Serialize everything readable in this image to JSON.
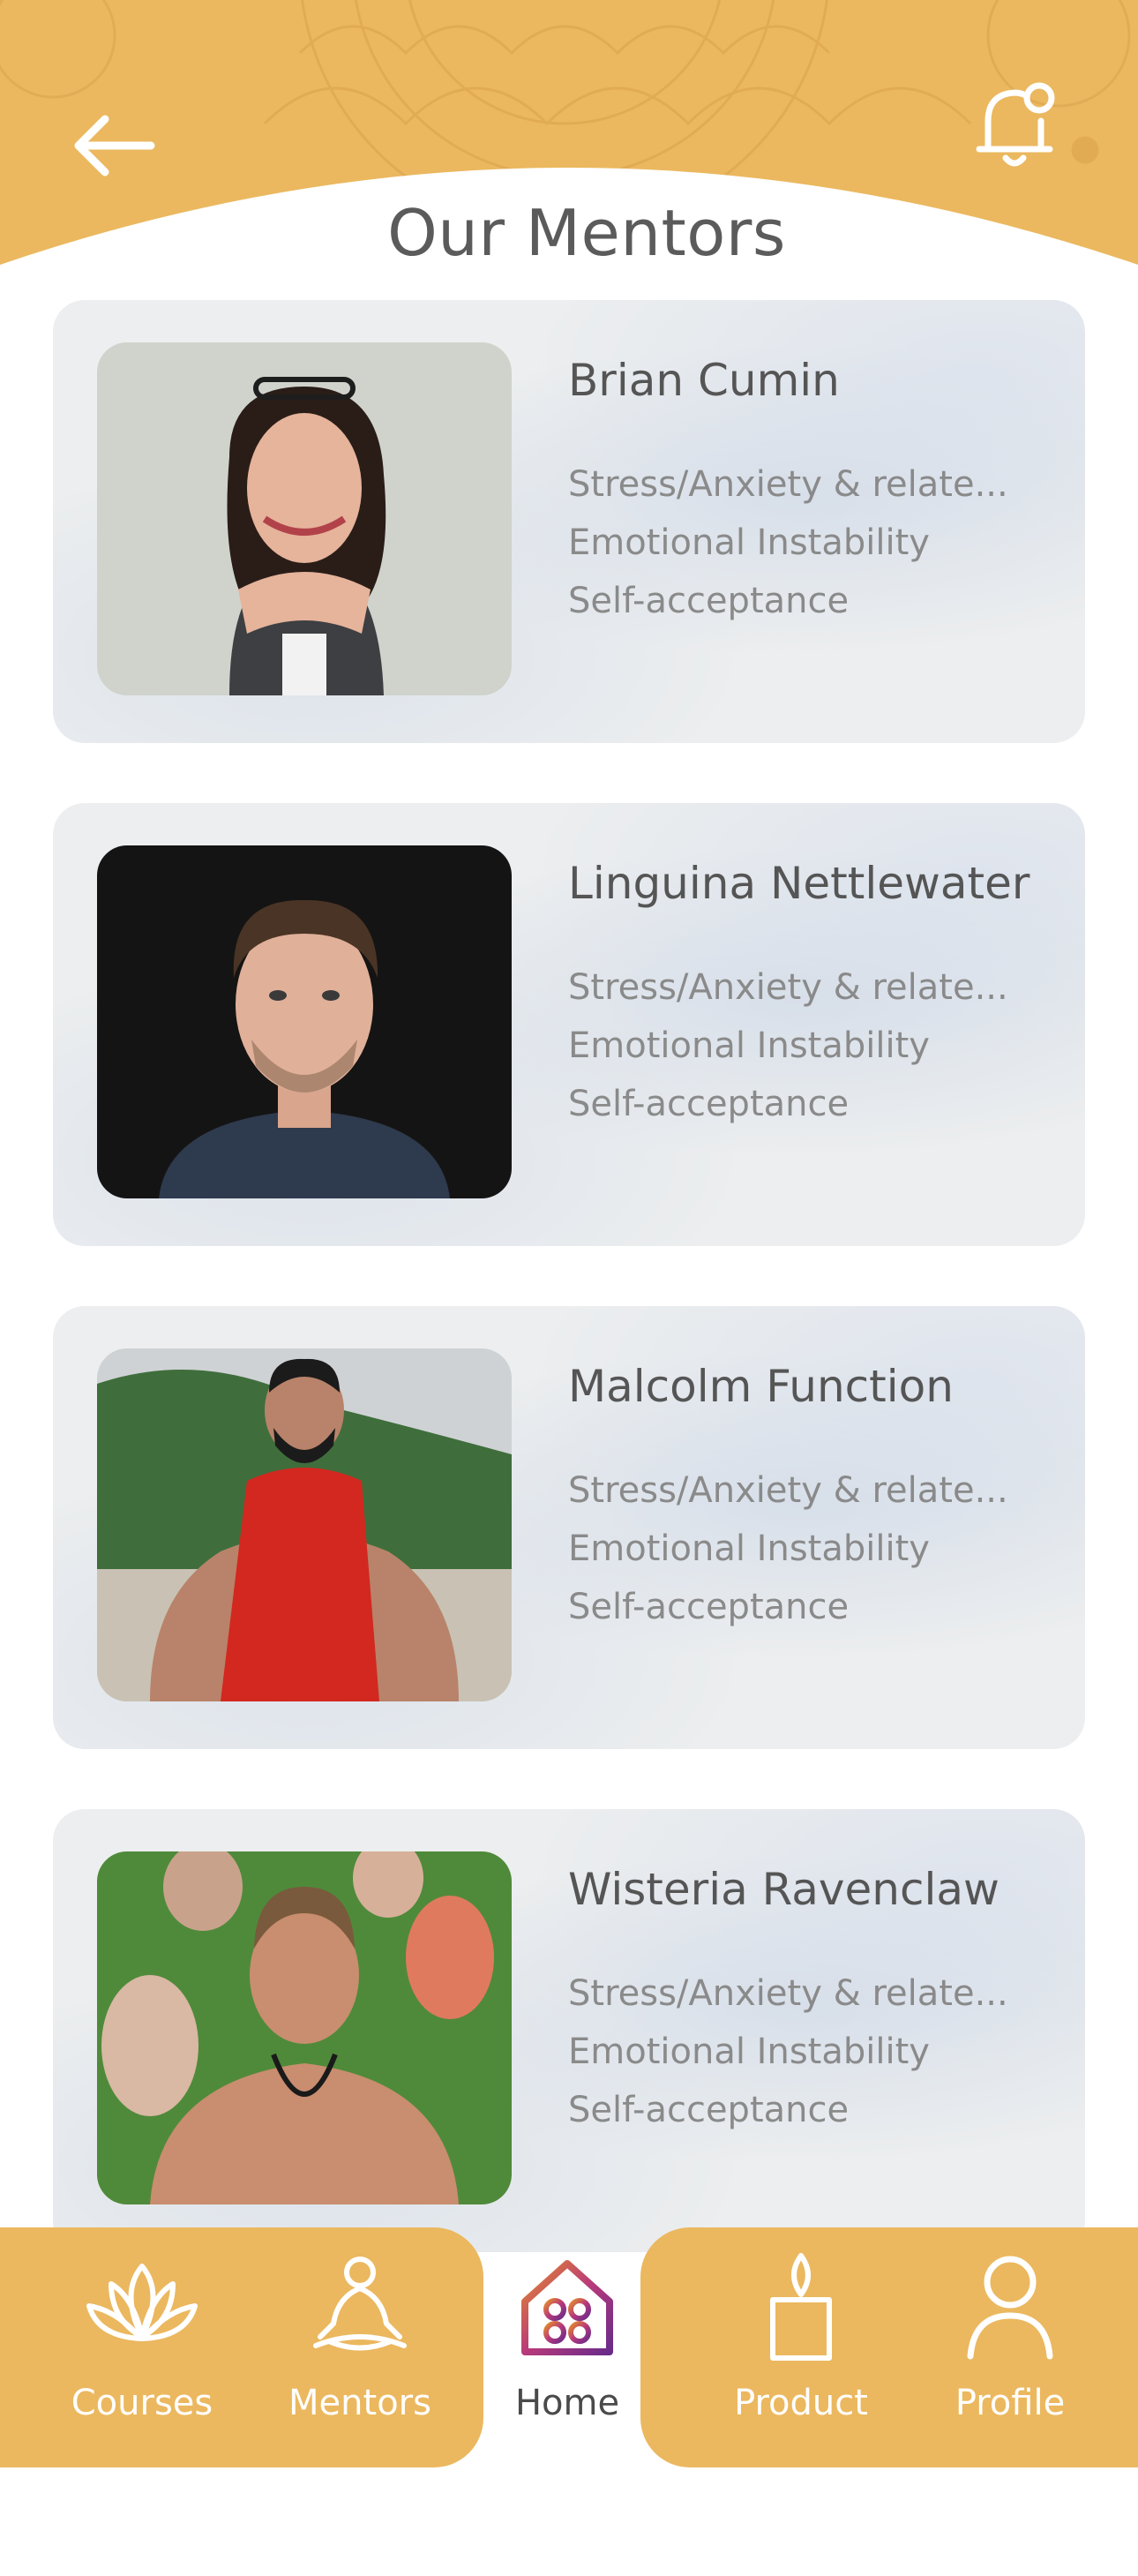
{
  "header": {
    "title": "Our Mentors",
    "back_icon": "arrow-left-icon",
    "notification_icon": "bell-icon"
  },
  "mentors": [
    {
      "name": "Brian Cumin",
      "tags": [
        "Stress/Anxiety & relate...",
        "Emotional Instability",
        "Self-acceptance"
      ],
      "photo": "woman-portrait-photo"
    },
    {
      "name": "Linguina Nettlewater",
      "tags": [
        "Stress/Anxiety & relate...",
        "Emotional Instability",
        "Self-acceptance"
      ],
      "photo": "man-portrait-photo"
    },
    {
      "name": "Malcolm Function",
      "tags": [
        "Stress/Anxiety & relate...",
        "Emotional Instability",
        "Self-acceptance"
      ],
      "photo": "meditating-man-red-robe-photo"
    },
    {
      "name": "Wisteria Ravenclaw",
      "tags": [
        "Stress/Anxiety & relate...",
        "Emotional Instability",
        "Self-acceptance"
      ],
      "photo": "group-meditation-photo"
    }
  ],
  "nav": {
    "items": [
      {
        "label": "Courses",
        "icon": "lotus-icon"
      },
      {
        "label": "Mentors",
        "icon": "meditation-figure-icon"
      },
      {
        "label": "Home",
        "icon": "home-icon",
        "active": true
      },
      {
        "label": "Product",
        "icon": "candle-icon"
      },
      {
        "label": "Profile",
        "icon": "person-icon"
      }
    ]
  },
  "colors": {
    "accent": "#ebb85f",
    "title_text": "#5b5b5b",
    "tag_text": "#8a8a8a",
    "card_bg": "#eceeef"
  }
}
